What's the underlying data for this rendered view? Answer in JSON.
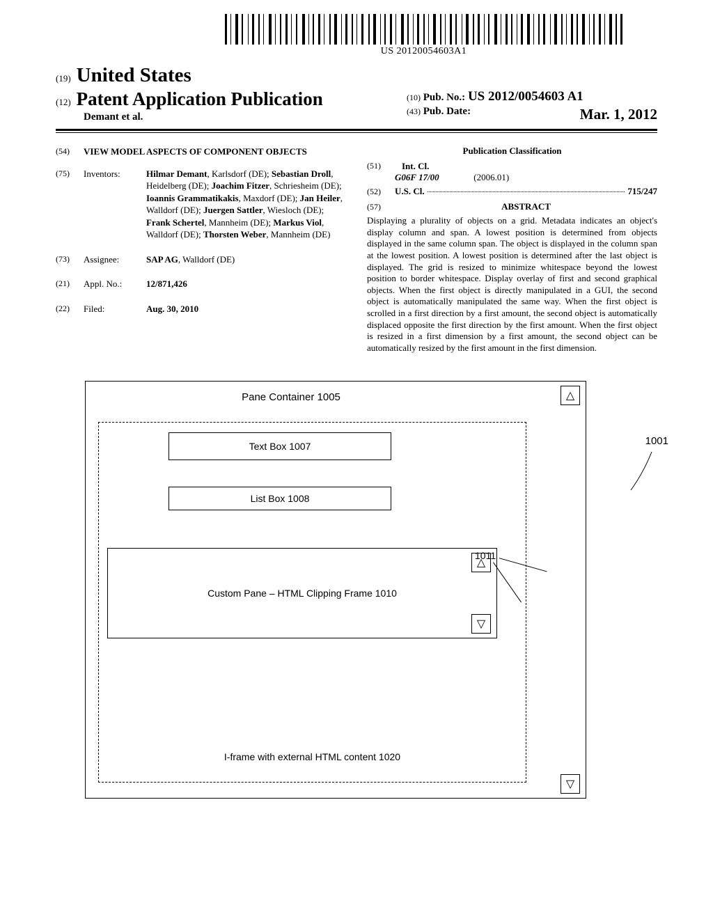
{
  "barcode_number": "US 20120054603A1",
  "header": {
    "code19": "(19)",
    "country": "United States",
    "code12": "(12)",
    "pub_type": "Patent Application Publication",
    "authors_line": "Demant et al.",
    "code10": "(10)",
    "pub_no_label": "Pub. No.:",
    "pub_no_value": "US 2012/0054603 A1",
    "code43": "(43)",
    "pub_date_label": "Pub. Date:",
    "pub_date_value": "Mar. 1, 2012"
  },
  "left": {
    "title_code": "(54)",
    "title": "VIEW MODEL ASPECTS OF COMPONENT OBJECTS",
    "inventors_code": "(75)",
    "inventors_label": "Inventors:",
    "inventors": [
      {
        "name": "Hilmar Demant",
        "loc": ", Karlsdorf (DE); "
      },
      {
        "name": "Sebastian Droll",
        "loc": ", Heidelberg (DE); "
      },
      {
        "name": "Joachim Fitzer",
        "loc": ", Schriesheim (DE); "
      },
      {
        "name": "Ioannis Grammatikakis",
        "loc": ", Maxdorf (DE); "
      },
      {
        "name": "Jan Heiler",
        "loc": ", Walldorf (DE); "
      },
      {
        "name": "Juergen Sattler",
        "loc": ", Wiesloch (DE); "
      },
      {
        "name": "Frank Schertel",
        "loc": ", Mannheim (DE); "
      },
      {
        "name": "Markus Viol",
        "loc": ", Walldorf (DE); "
      },
      {
        "name": "Thorsten Weber",
        "loc": ", Mannheim (DE)"
      }
    ],
    "assignee_code": "(73)",
    "assignee_label": "Assignee:",
    "assignee_name": "SAP AG",
    "assignee_loc": ", Walldorf (DE)",
    "appl_code": "(21)",
    "appl_label": "Appl. No.:",
    "appl_value": "12/871,426",
    "filed_code": "(22)",
    "filed_label": "Filed:",
    "filed_value": "Aug. 30, 2010"
  },
  "right": {
    "class_head": "Publication Classification",
    "intcl_code": "(51)",
    "intcl_label": "Int. Cl.",
    "intcl_main": "G06F 17/00",
    "intcl_year": "(2006.01)",
    "uscl_code": "(52)",
    "uscl_label": "U.S. Cl.",
    "uscl_value": "715/247",
    "abstract_code": "(57)",
    "abstract_head": "ABSTRACT",
    "abstract_text": "Displaying a plurality of objects on a grid. Metadata indicates an object's display column and span. A lowest position is determined from objects displayed in the same column span. The object is displayed in the column span at the lowest position. A lowest position is determined after the last object is displayed. The grid is resized to minimize whitespace beyond the lowest position to border whitespace. Display overlay of first and second graphical objects. When the first object is directly manipulated in a GUI, the second object is automatically manipulated the same way. When the first object is scrolled in a first direction by a first amount, the second object is automatically displaced opposite the first direction by the first amount. When the first object is resized in a first dimension by a first amount, the second object can be automatically resized by the first amount in the first dimension."
  },
  "figure": {
    "pane_title": "Pane Container 1005",
    "text_box": "Text Box 1007",
    "list_box": "List Box 1008",
    "custom_pane": "Custom Pane – HTML Clipping Frame 1010",
    "iframe_label": "I-frame with external HTML content 1020",
    "label_1011": "1011",
    "label_1001": "1001",
    "arrow_up": "△",
    "arrow_down": "▽"
  }
}
